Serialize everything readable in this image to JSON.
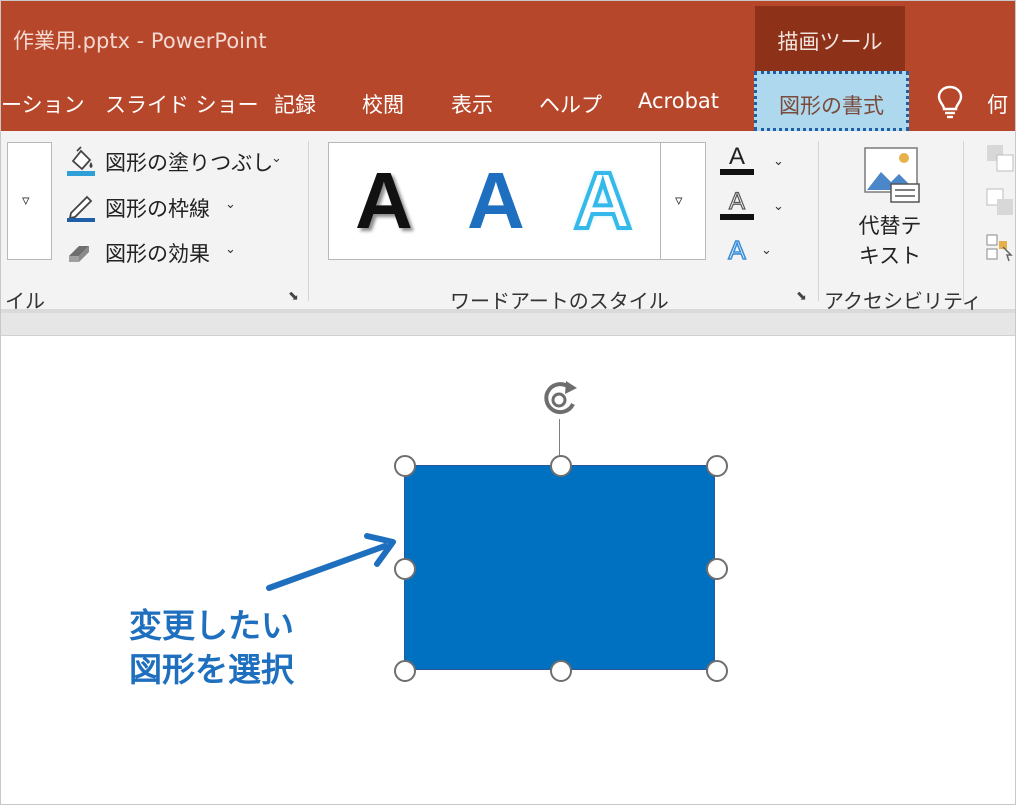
{
  "app": {
    "title": "作業用.pptx  -  PowerPoint",
    "contextual_tab_group": "描画ツール"
  },
  "tabs": [
    {
      "label": "ーション"
    },
    {
      "label": "スライド ショー"
    },
    {
      "label": "記録"
    },
    {
      "label": "校閲"
    },
    {
      "label": "表示"
    },
    {
      "label": "ヘルプ"
    },
    {
      "label": "Acrobat"
    },
    {
      "label": "図形の書式",
      "active": true
    },
    {
      "label": "何"
    }
  ],
  "ribbon": {
    "shape_styles_group_label": "イル",
    "commands": {
      "fill": "図形の塗りつぶし",
      "outline": "図形の枠線",
      "effects": "図形の効果"
    },
    "wordart": {
      "group_label": "ワードアートのスタイル",
      "samples": [
        "A",
        "A",
        "A"
      ],
      "text_fill_icon": "A",
      "text_outline_icon": "A",
      "text_effects_icon": "A"
    },
    "accessibility": {
      "group_label": "アクセシビリティ",
      "alt_text_line1": "代替テ",
      "alt_text_line2": "キスト"
    }
  },
  "slide": {
    "shape_fill": "#0070c0",
    "annotation_line1": "変更したい",
    "annotation_line2": "図形を選択"
  },
  "colors": {
    "title_bar": "#b7472a",
    "contextual_group": "#8d3218",
    "active_tab": "#add8ee",
    "annotation": "#1f6fbf"
  }
}
